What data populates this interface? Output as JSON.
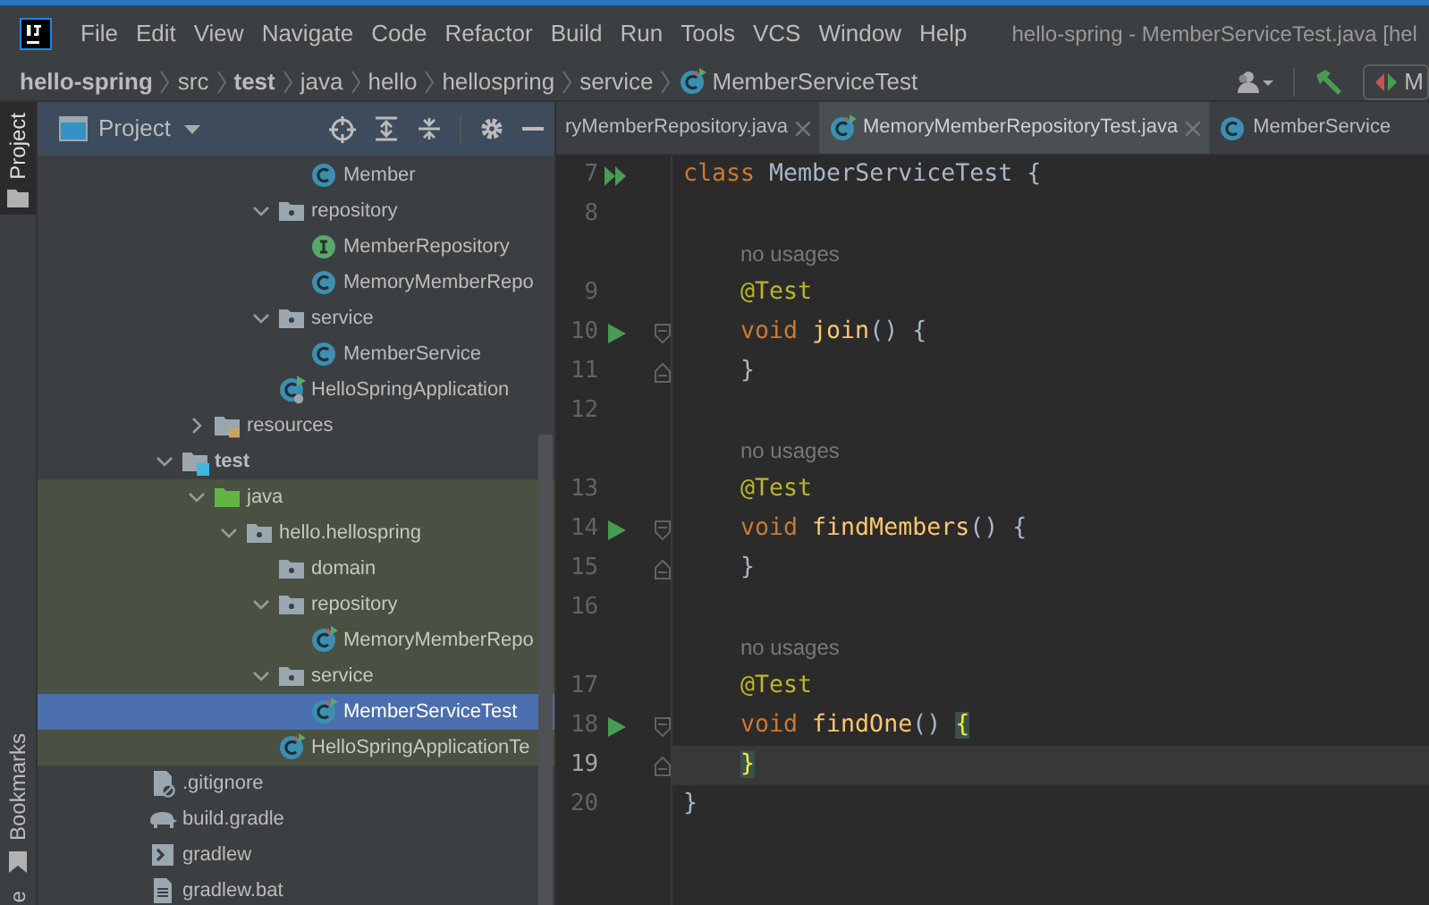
{
  "window": {
    "title": "hello-spring - MemberServiceTest.java [hel"
  },
  "menu": [
    {
      "label": "File"
    },
    {
      "label": "Edit"
    },
    {
      "label": "View"
    },
    {
      "label": "Navigate"
    },
    {
      "label": "Code"
    },
    {
      "label": "Refactor"
    },
    {
      "label": "Build"
    },
    {
      "label": "Run"
    },
    {
      "label": "Tools"
    },
    {
      "label": "VCS"
    },
    {
      "label": "Window"
    },
    {
      "label": "Help"
    }
  ],
  "breadcrumbs": [
    {
      "label": "hello-spring",
      "bold": true
    },
    {
      "label": "src",
      "bold": false
    },
    {
      "label": "test",
      "bold": true
    },
    {
      "label": "java",
      "bold": false
    },
    {
      "label": "hello",
      "bold": false
    },
    {
      "label": "hellospring",
      "bold": false
    },
    {
      "label": "service",
      "bold": false
    },
    {
      "label": "MemberServiceTest",
      "bold": false,
      "kind": "test-class"
    }
  ],
  "run_config": {
    "label": "M"
  },
  "side_strip": [
    {
      "label": "Project",
      "selected": true,
      "kind": "project"
    },
    {
      "label": "Bookmarks",
      "selected": false,
      "kind": "bookmarks"
    },
    {
      "label": "e",
      "selected": false,
      "kind": "cut"
    }
  ],
  "project_panel": {
    "title": "Project",
    "tree": [
      {
        "children": [
          {
            "children": [
              {
                "children": [
                  {
                    "children": [
                      {
                        "children": [
                          {
                            "label": "Member",
                            "kind": "class",
                            "selected": false
                          }
                        ]
                      },
                      {
                        "label": "repository",
                        "kind": "package",
                        "expanded": true,
                        "selected": false,
                        "children": [
                          {
                            "label": "MemberRepository",
                            "kind": "interface",
                            "selected": false
                          },
                          {
                            "label": "MemoryMemberRepo",
                            "kind": "class",
                            "selected": false
                          }
                        ]
                      },
                      {
                        "label": "service",
                        "kind": "package",
                        "expanded": true,
                        "selected": false,
                        "children": [
                          {
                            "label": "MemberService",
                            "kind": "class",
                            "selected": false
                          }
                        ]
                      },
                      {
                        "label": "HelloSpringApplication",
                        "kind": "app",
                        "selected": false
                      }
                    ]
                  }
                ]
              },
              {
                "label": "resources",
                "kind": "resources",
                "expanded": false,
                "selected": false
              }
            ]
          },
          {
            "label": "test",
            "kind": "test-root",
            "expanded": true,
            "selected": false,
            "children": [
              {
                "label": "java",
                "kind": "test-sources",
                "expanded": true,
                "test_source": true,
                "selected": false,
                "children": [
                  {
                    "label": "hello.hellospring",
                    "kind": "package",
                    "expanded": true,
                    "selected": false,
                    "children": [
                      {
                        "label": "domain",
                        "kind": "package",
                        "selected": false
                      },
                      {
                        "label": "repository",
                        "kind": "package",
                        "expanded": true,
                        "selected": false,
                        "children": [
                          {
                            "label": "MemoryMemberRepo",
                            "kind": "test-class",
                            "selected": false
                          }
                        ]
                      },
                      {
                        "label": "service",
                        "kind": "package",
                        "expanded": true,
                        "selected": false,
                        "children": [
                          {
                            "label": "MemberServiceTest",
                            "kind": "test-class",
                            "selected": true
                          }
                        ]
                      },
                      {
                        "label": "HelloSpringApplicationTe",
                        "kind": "test-app",
                        "selected": false
                      }
                    ]
                  }
                ]
              }
            ]
          }
        ]
      },
      {
        "label": ".gitignore",
        "kind": "ignore",
        "selected": false
      },
      {
        "label": "build.gradle",
        "kind": "gradle",
        "selected": false
      },
      {
        "label": "gradlew",
        "kind": "script",
        "selected": false
      },
      {
        "label": "gradlew.bat",
        "kind": "bat",
        "selected": false
      }
    ]
  },
  "editor_tabs": [
    {
      "label": "ryMemberRepository.java",
      "selected": false,
      "closable": true
    },
    {
      "label": "MemoryMemberRepositoryTest.java",
      "kind": "test-class",
      "selected": true,
      "closable": true
    },
    {
      "label": "MemberService",
      "kind": "class",
      "selected": false,
      "closable": false
    }
  ],
  "editor": {
    "lines": [
      {
        "kind": "code",
        "number": "7",
        "gutter": {
          "kind": "run-all"
        },
        "tokens": [
          {
            "kind": "keyword",
            "text": "class"
          },
          {
            "kind": "plain",
            "text": " MemberServiceTest {"
          }
        ],
        "children": [
          {
            "kind": "code",
            "number": "8"
          },
          {
            "kind": "inlay",
            "text": "no usages"
          },
          {
            "kind": "code",
            "number": "9",
            "tokens": [
              {
                "kind": "annotation",
                "text": "@Test"
              }
            ]
          },
          {
            "kind": "code",
            "number": "10",
            "gutter": {
              "kind": "run"
            },
            "fold": {
              "kind": "start"
            },
            "tokens": [
              {
                "kind": "keyword",
                "text": "void"
              },
              {
                "kind": "method",
                "text": " join"
              },
              {
                "kind": "plain",
                "text": "() {"
              }
            ]
          },
          {
            "kind": "code",
            "number": "11",
            "fold": {
              "kind": "end"
            },
            "tokens": [
              {
                "kind": "plain",
                "text": "}"
              }
            ]
          },
          {
            "kind": "code",
            "number": "12"
          },
          {
            "kind": "inlay",
            "text": "no usages"
          },
          {
            "kind": "code",
            "number": "13",
            "tokens": [
              {
                "kind": "annotation",
                "text": "@Test"
              }
            ]
          },
          {
            "kind": "code",
            "number": "14",
            "gutter": {
              "kind": "run"
            },
            "fold": {
              "kind": "start"
            },
            "tokens": [
              {
                "kind": "keyword",
                "text": "void"
              },
              {
                "kind": "method",
                "text": " findMembers"
              },
              {
                "kind": "plain",
                "text": "() {"
              }
            ]
          },
          {
            "kind": "code",
            "number": "15",
            "fold": {
              "kind": "end"
            },
            "tokens": [
              {
                "kind": "plain",
                "text": "}"
              }
            ]
          },
          {
            "kind": "code",
            "number": "16"
          },
          {
            "kind": "inlay",
            "text": "no usages"
          },
          {
            "kind": "code",
            "number": "17",
            "tokens": [
              {
                "kind": "annotation",
                "text": "@Test"
              }
            ]
          },
          {
            "kind": "code",
            "number": "18",
            "gutter": {
              "kind": "run"
            },
            "fold": {
              "kind": "start"
            },
            "tokens": [
              {
                "kind": "keyword",
                "text": "void"
              },
              {
                "kind": "method",
                "text": " findOne"
              },
              {
                "kind": "plain",
                "text": "() "
              },
              {
                "kind": "brace-match",
                "text": "{"
              }
            ]
          },
          {
            "kind": "code",
            "number": "19",
            "fold": {
              "kind": "end"
            },
            "current": true,
            "tokens": [
              {
                "kind": "brace-match",
                "text": "}"
              }
            ]
          }
        ]
      },
      {
        "kind": "code",
        "number": "20",
        "tokens": [
          {
            "kind": "plain",
            "text": "}"
          }
        ]
      }
    ]
  }
}
